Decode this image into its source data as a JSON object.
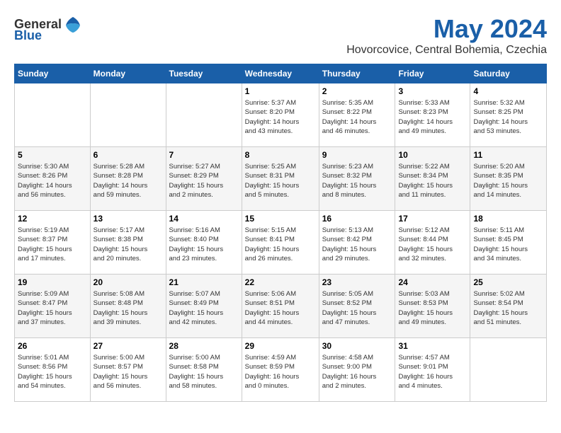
{
  "header": {
    "logo_general": "General",
    "logo_blue": "Blue",
    "month_year": "May 2024",
    "location": "Hovorcovice, Central Bohemia, Czechia"
  },
  "days_of_week": [
    "Sunday",
    "Monday",
    "Tuesday",
    "Wednesday",
    "Thursday",
    "Friday",
    "Saturday"
  ],
  "weeks": [
    [
      {
        "num": "",
        "info": ""
      },
      {
        "num": "",
        "info": ""
      },
      {
        "num": "",
        "info": ""
      },
      {
        "num": "1",
        "info": "Sunrise: 5:37 AM\nSunset: 8:20 PM\nDaylight: 14 hours\nand 43 minutes."
      },
      {
        "num": "2",
        "info": "Sunrise: 5:35 AM\nSunset: 8:22 PM\nDaylight: 14 hours\nand 46 minutes."
      },
      {
        "num": "3",
        "info": "Sunrise: 5:33 AM\nSunset: 8:23 PM\nDaylight: 14 hours\nand 49 minutes."
      },
      {
        "num": "4",
        "info": "Sunrise: 5:32 AM\nSunset: 8:25 PM\nDaylight: 14 hours\nand 53 minutes."
      }
    ],
    [
      {
        "num": "5",
        "info": "Sunrise: 5:30 AM\nSunset: 8:26 PM\nDaylight: 14 hours\nand 56 minutes."
      },
      {
        "num": "6",
        "info": "Sunrise: 5:28 AM\nSunset: 8:28 PM\nDaylight: 14 hours\nand 59 minutes."
      },
      {
        "num": "7",
        "info": "Sunrise: 5:27 AM\nSunset: 8:29 PM\nDaylight: 15 hours\nand 2 minutes."
      },
      {
        "num": "8",
        "info": "Sunrise: 5:25 AM\nSunset: 8:31 PM\nDaylight: 15 hours\nand 5 minutes."
      },
      {
        "num": "9",
        "info": "Sunrise: 5:23 AM\nSunset: 8:32 PM\nDaylight: 15 hours\nand 8 minutes."
      },
      {
        "num": "10",
        "info": "Sunrise: 5:22 AM\nSunset: 8:34 PM\nDaylight: 15 hours\nand 11 minutes."
      },
      {
        "num": "11",
        "info": "Sunrise: 5:20 AM\nSunset: 8:35 PM\nDaylight: 15 hours\nand 14 minutes."
      }
    ],
    [
      {
        "num": "12",
        "info": "Sunrise: 5:19 AM\nSunset: 8:37 PM\nDaylight: 15 hours\nand 17 minutes."
      },
      {
        "num": "13",
        "info": "Sunrise: 5:17 AM\nSunset: 8:38 PM\nDaylight: 15 hours\nand 20 minutes."
      },
      {
        "num": "14",
        "info": "Sunrise: 5:16 AM\nSunset: 8:40 PM\nDaylight: 15 hours\nand 23 minutes."
      },
      {
        "num": "15",
        "info": "Sunrise: 5:15 AM\nSunset: 8:41 PM\nDaylight: 15 hours\nand 26 minutes."
      },
      {
        "num": "16",
        "info": "Sunrise: 5:13 AM\nSunset: 8:42 PM\nDaylight: 15 hours\nand 29 minutes."
      },
      {
        "num": "17",
        "info": "Sunrise: 5:12 AM\nSunset: 8:44 PM\nDaylight: 15 hours\nand 32 minutes."
      },
      {
        "num": "18",
        "info": "Sunrise: 5:11 AM\nSunset: 8:45 PM\nDaylight: 15 hours\nand 34 minutes."
      }
    ],
    [
      {
        "num": "19",
        "info": "Sunrise: 5:09 AM\nSunset: 8:47 PM\nDaylight: 15 hours\nand 37 minutes."
      },
      {
        "num": "20",
        "info": "Sunrise: 5:08 AM\nSunset: 8:48 PM\nDaylight: 15 hours\nand 39 minutes."
      },
      {
        "num": "21",
        "info": "Sunrise: 5:07 AM\nSunset: 8:49 PM\nDaylight: 15 hours\nand 42 minutes."
      },
      {
        "num": "22",
        "info": "Sunrise: 5:06 AM\nSunset: 8:51 PM\nDaylight: 15 hours\nand 44 minutes."
      },
      {
        "num": "23",
        "info": "Sunrise: 5:05 AM\nSunset: 8:52 PM\nDaylight: 15 hours\nand 47 minutes."
      },
      {
        "num": "24",
        "info": "Sunrise: 5:03 AM\nSunset: 8:53 PM\nDaylight: 15 hours\nand 49 minutes."
      },
      {
        "num": "25",
        "info": "Sunrise: 5:02 AM\nSunset: 8:54 PM\nDaylight: 15 hours\nand 51 minutes."
      }
    ],
    [
      {
        "num": "26",
        "info": "Sunrise: 5:01 AM\nSunset: 8:56 PM\nDaylight: 15 hours\nand 54 minutes."
      },
      {
        "num": "27",
        "info": "Sunrise: 5:00 AM\nSunset: 8:57 PM\nDaylight: 15 hours\nand 56 minutes."
      },
      {
        "num": "28",
        "info": "Sunrise: 5:00 AM\nSunset: 8:58 PM\nDaylight: 15 hours\nand 58 minutes."
      },
      {
        "num": "29",
        "info": "Sunrise: 4:59 AM\nSunset: 8:59 PM\nDaylight: 16 hours\nand 0 minutes."
      },
      {
        "num": "30",
        "info": "Sunrise: 4:58 AM\nSunset: 9:00 PM\nDaylight: 16 hours\nand 2 minutes."
      },
      {
        "num": "31",
        "info": "Sunrise: 4:57 AM\nSunset: 9:01 PM\nDaylight: 16 hours\nand 4 minutes."
      },
      {
        "num": "",
        "info": ""
      }
    ]
  ]
}
